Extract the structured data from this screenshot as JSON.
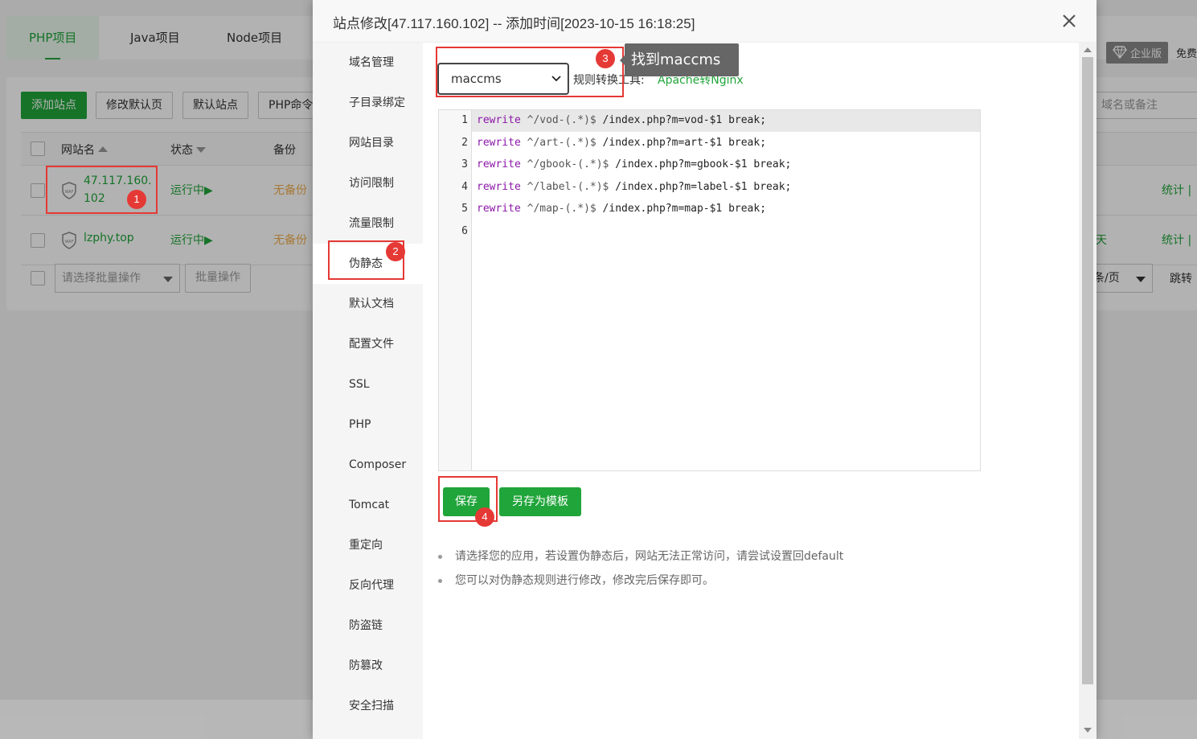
{
  "project_tabs": [
    {
      "label": "PHP项目"
    },
    {
      "label": "Java项目"
    },
    {
      "label": "Node项目"
    }
  ],
  "top_right": {
    "edition": "企业版",
    "free_text": "免费"
  },
  "toolbar": {
    "add_site": "添加站点",
    "modify_default": "修改默认页",
    "default_site": "默认站点",
    "php_cmd": "PHP命令",
    "search_placeholder": "域名或备注"
  },
  "table": {
    "headers": {
      "name": "网站名",
      "status": "状态",
      "backup": "备份"
    },
    "rows": [
      {
        "name": "47.117.160.102",
        "name_line1": "47.117.160.",
        "name_line2": "102",
        "status": "运行中▶",
        "backup": "无备份",
        "action": "统计 |"
      },
      {
        "name": "lzphy.top",
        "status": "运行中▶",
        "backup": "无备份",
        "days": "天",
        "action": "统计 |"
      }
    ]
  },
  "bottom_bar": {
    "batch_select": "请选择批量操作",
    "batch_button": "批量操作",
    "per_page": "条/页",
    "jump": "跳转"
  },
  "modal": {
    "title": "站点修改[47.117.160.102] -- 添加时间[2023-10-15 16:18:25]",
    "nav": [
      {
        "label": "域名管理"
      },
      {
        "label": "子目录绑定"
      },
      {
        "label": "网站目录"
      },
      {
        "label": "访问限制"
      },
      {
        "label": "流量限制"
      },
      {
        "label": "伪静态"
      },
      {
        "label": "默认文档"
      },
      {
        "label": "配置文件"
      },
      {
        "label": "SSL"
      },
      {
        "label": "PHP"
      },
      {
        "label": "Composer"
      },
      {
        "label": "Tomcat"
      },
      {
        "label": "重定向"
      },
      {
        "label": "反向代理"
      },
      {
        "label": "防盗链"
      },
      {
        "label": "防篡改"
      },
      {
        "label": "安全扫描"
      }
    ],
    "rule_select_value": "maccms",
    "convert_label": "规则转换工具:",
    "convert_link": "Apache转Nginx",
    "editor": {
      "line_numbers": [
        "1",
        "2",
        "3",
        "4",
        "5",
        "6"
      ],
      "lines": [
        {
          "kw": "rewrite",
          "pattern": " ^/vod-(.*)$",
          "rest": " /index.php?m=vod-$1 break;"
        },
        {
          "kw": "rewrite",
          "pattern": " ^/art-(.*)$",
          "rest": " /index.php?m=art-$1 break;"
        },
        {
          "kw": "rewrite",
          "pattern": " ^/gbook-(.*)$",
          "rest": " /index.php?m=gbook-$1 break;"
        },
        {
          "kw": "rewrite",
          "pattern": " ^/label-(.*)$",
          "rest": " /index.php?m=label-$1 break;"
        },
        {
          "kw": "rewrite",
          "pattern": " ^/map-(.*)$",
          "rest": " /index.php?m=map-$1 break;"
        }
      ]
    },
    "save_button": "保存",
    "save_template_button": "另存为模板",
    "tips": [
      "请选择您的应用，若设置伪静态后，网站无法正常访问，请尝试设置回default",
      "您可以对伪静态规则进行修改，修改完后保存即可。"
    ]
  },
  "annotations": {
    "badges": [
      "1",
      "2",
      "3",
      "4"
    ],
    "tooltip": "找到maccms"
  },
  "colors": {
    "brand_green": "#20a53a",
    "annotation_red": "#e53935",
    "warning_orange": "#f0ad4e"
  }
}
